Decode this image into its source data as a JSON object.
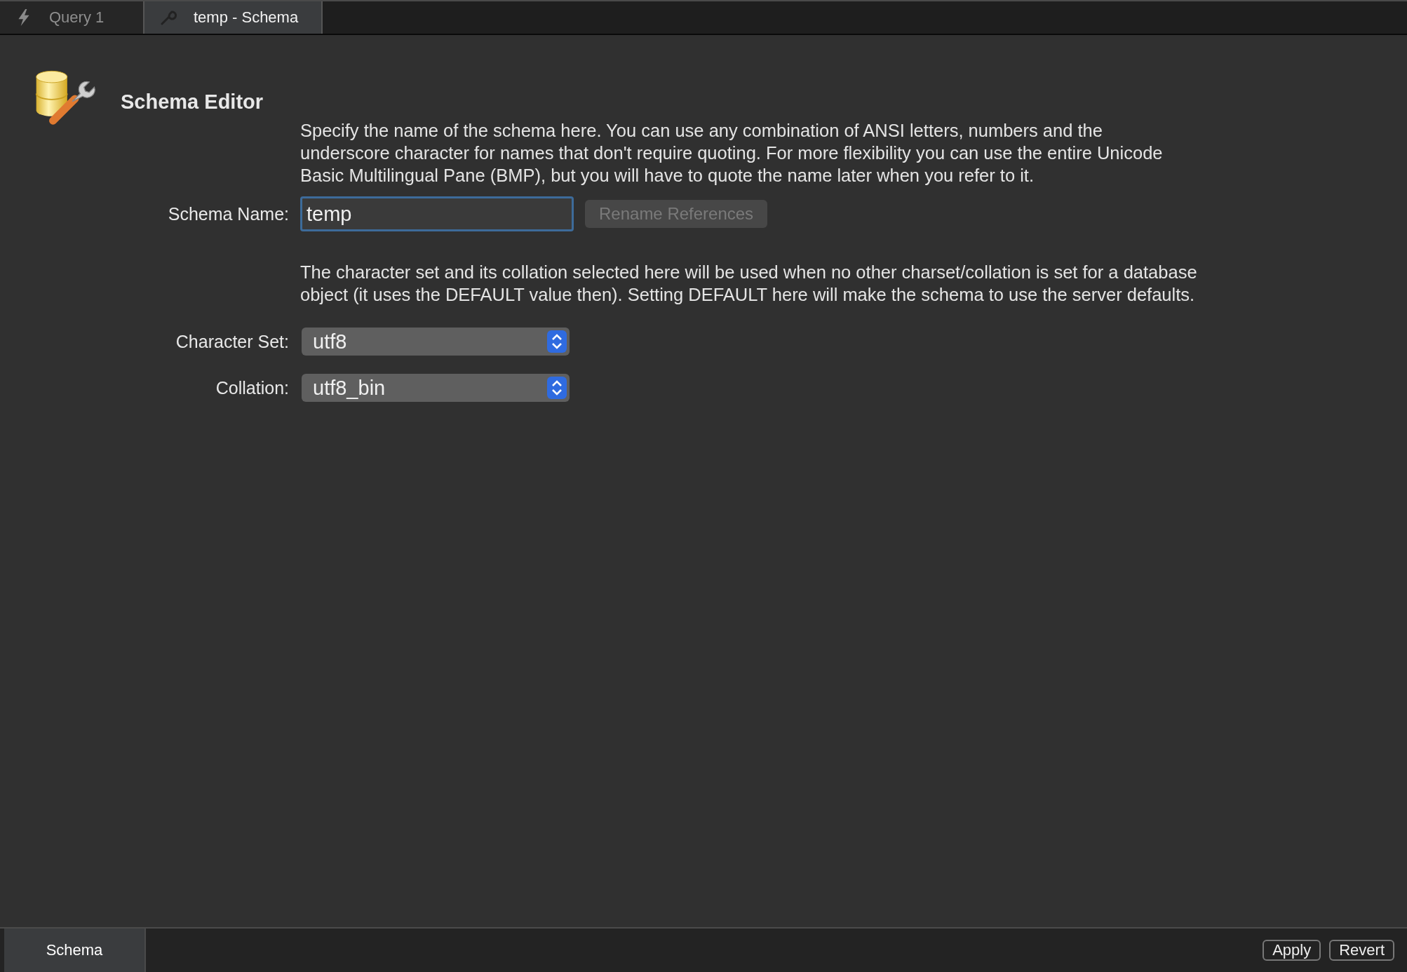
{
  "tabs": [
    {
      "label": "Query 1",
      "kind": "query",
      "selected": false
    },
    {
      "label": "temp - Schema",
      "kind": "schema",
      "selected": true
    }
  ],
  "editor": {
    "title": "Schema Editor",
    "name_help": "Specify the name of the schema here. You can use any combination of ANSI letters, numbers and the underscore character for names that don't require quoting. For more flexibility you can use the entire Unicode Basic Multilingual Pane (BMP), but you will have to quote the name later when you refer to it.",
    "name_label": "Schema Name:",
    "name_value": "temp",
    "rename_button": {
      "label": "Rename References",
      "disabled": true
    },
    "charset_help": "The character set and its collation selected here will be used when no other charset/collation is set for a database object (it uses the DEFAULT value then). Setting DEFAULT here will make the schema to use the server defaults.",
    "selects": [
      {
        "label": "Character Set:",
        "value": "utf8"
      },
      {
        "label": "Collation:",
        "value": "utf8_bin"
      }
    ]
  },
  "bottom_tabs": [
    {
      "label": "Schema",
      "selected": true
    }
  ],
  "buttons": [
    "Apply",
    "Revert"
  ]
}
